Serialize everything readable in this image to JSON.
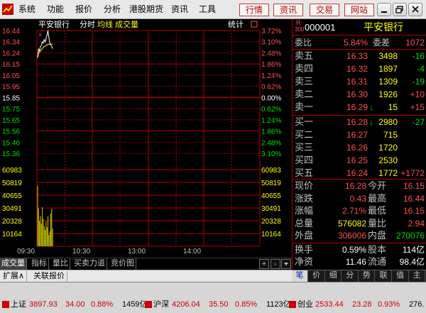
{
  "menu": {
    "items": [
      "系统",
      "功能",
      "报价",
      "分析",
      "港股期货",
      "资讯",
      "工具"
    ],
    "nav_buttons": [
      "行情",
      "资讯",
      "交易",
      "网站"
    ]
  },
  "chart": {
    "stock_name": "平安银行",
    "period": "分时",
    "indicator_1": "均线",
    "indicator_2": "成交量",
    "stats_label": "统计",
    "price_ticks": [
      "16.44",
      "16.34",
      "16.24",
      "16.15",
      "16.05",
      "15.95",
      "15.85",
      "15.75",
      "15.65",
      "15.56",
      "15.46",
      "15.36"
    ],
    "pct_ticks": [
      "3.72%",
      "3.10%",
      "2.48%",
      "1.86%",
      "1.24%",
      "0.62%",
      "0.00%",
      "0.62%",
      "1.24%",
      "1.86%",
      "2.48%",
      "3.10%"
    ],
    "volume_ticks": [
      "60983",
      "50819",
      "40655",
      "30491",
      "20328",
      "10164"
    ],
    "time_ticks": [
      "09:30",
      "10:30",
      "13:00",
      "14:00"
    ],
    "colors": {
      "up": "#ff5050",
      "down": "#00e000",
      "grid": "#b00000",
      "price_line": "#ffffff",
      "avg_line": "#ffff00",
      "volume": "#c8c800"
    }
  },
  "chart_data": {
    "type": "line",
    "title": "平安银行 分时",
    "x": [
      "09:30",
      "09:31",
      "09:32",
      "09:33",
      "09:34",
      "09:35",
      "09:36",
      "09:37",
      "09:38",
      "09:39",
      "09:40",
      "09:41",
      "09:42",
      "09:43",
      "09:44",
      "09:45",
      "09:46"
    ],
    "series": [
      {
        "name": "分时",
        "values": [
          16.2,
          16.28,
          16.26,
          16.3,
          16.31,
          16.34,
          16.33,
          16.36,
          16.34,
          16.37,
          16.4,
          16.44,
          16.38,
          16.33,
          16.31,
          16.3,
          16.28
        ]
      },
      {
        "name": "均线",
        "values": [
          16.2,
          16.24,
          16.25,
          16.26,
          16.27,
          16.28,
          16.29,
          16.3,
          16.3,
          16.31,
          16.31,
          16.32,
          16.32,
          16.32,
          16.32,
          16.32,
          16.32
        ]
      }
    ],
    "volume": [
      48000,
      30000,
      20000,
      24000,
      18000,
      31000,
      22000,
      16000,
      13000,
      20000,
      15000,
      24000,
      9000,
      12000,
      26000,
      30000,
      14000
    ],
    "ylim": [
      15.36,
      16.44
    ],
    "volume_ylim": [
      0,
      60983
    ],
    "reference_price": 15.85
  },
  "quote": {
    "code": "000001",
    "name": "平安银行",
    "market_tag": "R",
    "market_num": "300",
    "weibi_label": "委比",
    "weibi": "5.84%",
    "weicha_label": "委差",
    "weicha": "1072",
    "asks": [
      {
        "label": "卖五",
        "price": "16.33",
        "vol": "3498",
        "chg": "-16",
        "arrow": ""
      },
      {
        "label": "卖四",
        "price": "16.32",
        "vol": "1897",
        "chg": "-4",
        "arrow": ""
      },
      {
        "label": "卖三",
        "price": "16.31",
        "vol": "1309",
        "chg": "-19",
        "arrow": ""
      },
      {
        "label": "卖二",
        "price": "16.30",
        "vol": "1926",
        "chg": "+10",
        "arrow": ""
      },
      {
        "label": "卖一",
        "price": "16.29",
        "vol": "15",
        "chg": "+15",
        "arrow": "↓"
      }
    ],
    "bids": [
      {
        "label": "买一",
        "price": "16.28",
        "vol": "2980",
        "chg": "-27",
        "arrow": "↓"
      },
      {
        "label": "买二",
        "price": "16.27",
        "vol": "715",
        "chg": "",
        "arrow": ""
      },
      {
        "label": "买三",
        "price": "16.26",
        "vol": "1720",
        "chg": "",
        "arrow": ""
      },
      {
        "label": "买四",
        "price": "16.25",
        "vol": "2530",
        "chg": "",
        "arrow": ""
      },
      {
        "label": "买五",
        "price": "16.24",
        "vol": "1772",
        "chg": "+1772",
        "arrow": ""
      }
    ],
    "stats": [
      {
        "l1": "现价",
        "v1": "16.28",
        "l2": "今开",
        "v2": "16.15"
      },
      {
        "l1": "涨跌",
        "v1": "0.43",
        "l2": "最高",
        "v2": "16.44"
      },
      {
        "l1": "涨幅",
        "v1": "2.71%",
        "l2": "最低",
        "v2": "16.15"
      },
      {
        "l1": "总量",
        "v1": "576082",
        "l2": "量比",
        "v2": "2.94"
      },
      {
        "l1": "外盘",
        "v1": "306006",
        "l2": "内盘",
        "v2": "270076"
      }
    ],
    "extra": [
      {
        "l1": "换手",
        "v1": "0.59%",
        "l2": "股本",
        "v2": "114亿"
      },
      {
        "l1": "净资",
        "v1": "11.46",
        "l2": "流通",
        "v2": "98.4亿"
      }
    ]
  },
  "tabs": {
    "bottom": [
      "成交量",
      "指标",
      "量比",
      "买卖力道",
      "竞价图"
    ],
    "plus": "+",
    "minus": "-",
    "expand": [
      "扩展∧",
      "关联报价"
    ],
    "right": [
      "笔",
      "价",
      "细",
      "分",
      "势",
      "联",
      "值",
      "主"
    ]
  },
  "status": {
    "sh_label": "上证",
    "sh_index": "3897.93",
    "sh_change": "34.00",
    "sh_pct": "0.88%",
    "sh_amount": "1459亿",
    "sz_label": "沪深",
    "sz_index": "4206.04",
    "sz_change": "35.50",
    "sz_pct": "0.85%",
    "sz_amount": "1123亿",
    "cy_label": "创业",
    "cy_index": "2533.44",
    "cy_change": "23.28",
    "cy_pct": "0.93%",
    "cy_amount": "276."
  }
}
